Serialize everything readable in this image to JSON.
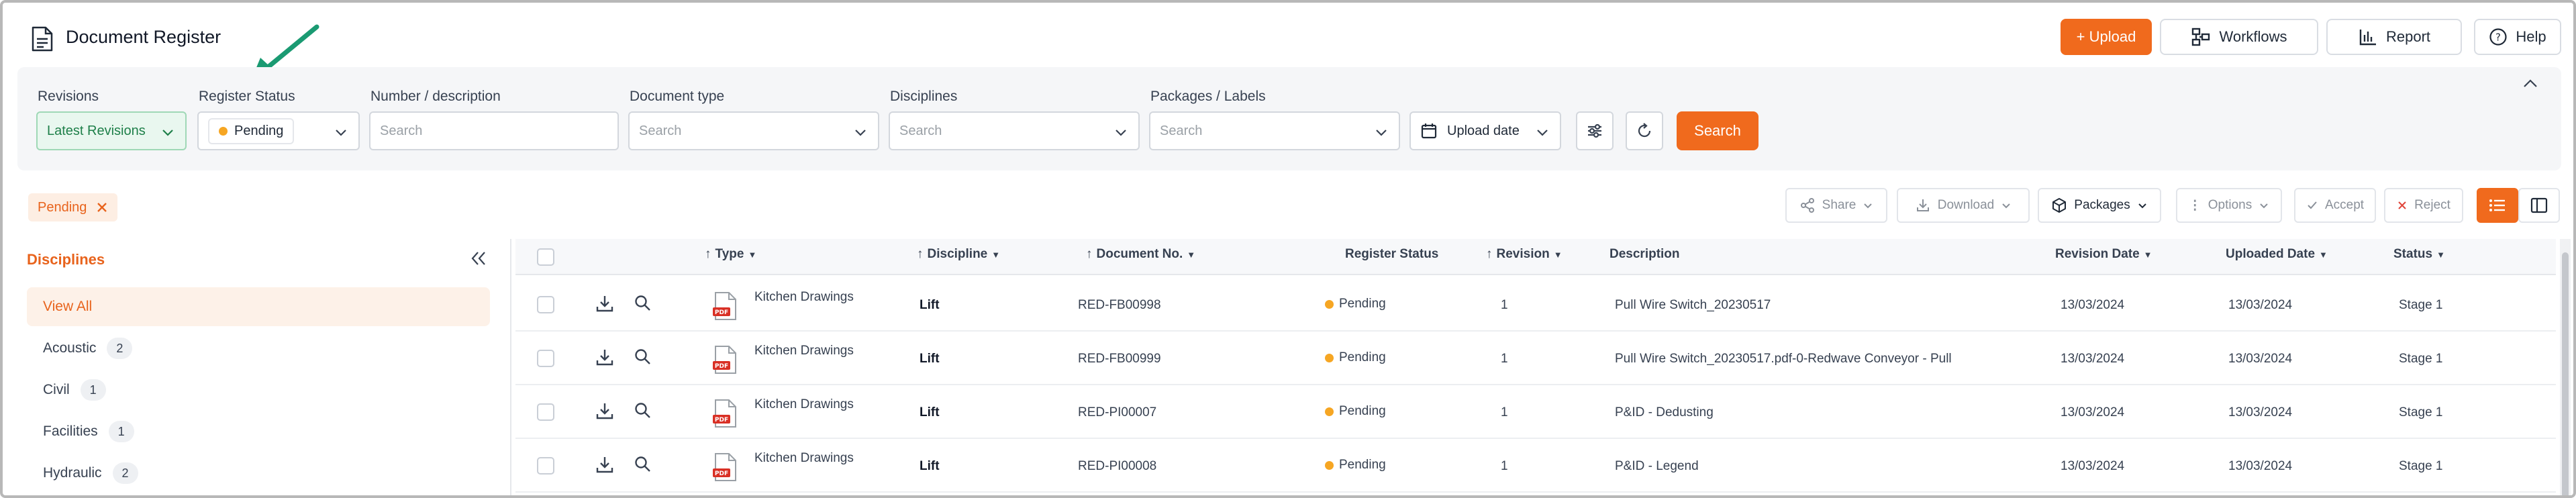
{
  "header": {
    "title": "Document Register",
    "upload_label": "+ Upload",
    "workflows_label": "Workflows",
    "report_label": "Report",
    "help_label": "Help"
  },
  "filters": {
    "revisions": {
      "label": "Revisions",
      "value": "Latest Revisions"
    },
    "register_status": {
      "label": "Register Status",
      "value": "Pending"
    },
    "number_description": {
      "label": "Number / description",
      "placeholder": "Search"
    },
    "document_type": {
      "label": "Document type",
      "placeholder": "Search"
    },
    "disciplines": {
      "label": "Disciplines",
      "placeholder": "Search"
    },
    "packages_labels": {
      "label": "Packages / Labels",
      "placeholder": "Search"
    },
    "upload_date_label": "Upload date",
    "search_label": "Search"
  },
  "active_filters": [
    {
      "label": "Pending"
    }
  ],
  "toolbar": {
    "share": "Share",
    "download": "Download",
    "packages": "Packages",
    "options": "Options",
    "accept": "Accept",
    "reject": "Reject"
  },
  "sidebar": {
    "title": "Disciplines",
    "items": [
      {
        "label": "View All",
        "count": null,
        "active": true
      },
      {
        "label": "Acoustic",
        "count": "2"
      },
      {
        "label": "Civil",
        "count": "1"
      },
      {
        "label": "Facilities",
        "count": "1"
      },
      {
        "label": "Hydraulic",
        "count": "2"
      }
    ]
  },
  "table": {
    "columns": {
      "type": "Type",
      "discipline": "Discipline",
      "document_no": "Document No.",
      "register_status": "Register Status",
      "revision": "Revision",
      "description": "Description",
      "revision_date": "Revision Date",
      "uploaded_date": "Uploaded Date",
      "status": "Status"
    },
    "rows": [
      {
        "type": "Kitchen Drawings",
        "file_badge": "PDF",
        "discipline": "Lift",
        "document_no": "RED-FB00998",
        "register_status": "Pending",
        "revision": "1",
        "description": "Pull Wire Switch_20230517",
        "revision_date": "13/03/2024",
        "uploaded_date": "13/03/2024",
        "status": "Stage 1"
      },
      {
        "type": "Kitchen Drawings",
        "file_badge": "PDF",
        "discipline": "Lift",
        "document_no": "RED-FB00999",
        "register_status": "Pending",
        "revision": "1",
        "description": "Pull Wire Switch_20230517.pdf-0-Redwave Conveyor - Pull",
        "revision_date": "13/03/2024",
        "uploaded_date": "13/03/2024",
        "status": "Stage 1"
      },
      {
        "type": "Kitchen Drawings",
        "file_badge": "PDF",
        "discipline": "Lift",
        "document_no": "RED-PI00007",
        "register_status": "Pending",
        "revision": "1",
        "description": "P&ID - Dedusting",
        "revision_date": "13/03/2024",
        "uploaded_date": "13/03/2024",
        "status": "Stage 1"
      },
      {
        "type": "Kitchen Drawings",
        "file_badge": "PDF",
        "discipline": "Lift",
        "document_no": "RED-PI00008",
        "register_status": "Pending",
        "revision": "1",
        "description": "P&ID - Legend",
        "revision_date": "13/03/2024",
        "uploaded_date": "13/03/2024",
        "status": "Stage 1"
      }
    ]
  },
  "colors": {
    "accent": "#f06a1d",
    "pending_dot": "#f6a623",
    "latest_chip_bg": "#e9f7ef",
    "annotation_arrow": "#1a9a72"
  }
}
